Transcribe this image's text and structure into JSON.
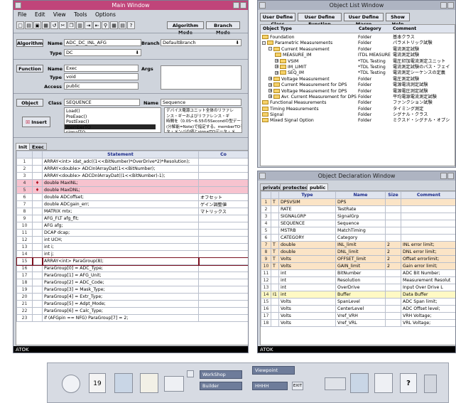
{
  "main_window": {
    "title": "Main Window",
    "menu": [
      "File",
      "Edit",
      "View",
      "Tools",
      "Options"
    ],
    "toolbar_algorithm_mode": "Algorithm Mode",
    "toolbar_branch_mode": "Branch Mode",
    "algorithm_button": "Algorithm",
    "name_label": "Name",
    "name_value": "ADC_DC_INL_AFG",
    "branch_label": "Branch",
    "branch_value": "DefaultBranch",
    "type_label": "Type",
    "type_value": "DC",
    "function_button": "Function",
    "fn_name_value": "Exec",
    "args_label": "Args",
    "fn_type_label": "Type",
    "fn_type_value": "void",
    "access_label": "Access",
    "access_value": "public",
    "object_button": "Object",
    "class_label": "Class",
    "class_value": "SEQUENCE",
    "obj_name_label": "Name",
    "obj_name_value": "Sequence",
    "insert_button": "Insert",
    "method_list": "Load()\nPreExec()\nPostExec()\nmemberTO\nsignalTO",
    "description": "デバイス電源ユニット全体のリファレ\nンス・ギーおよびリファレンス・ギ\n時間を（0.0S～6.55の5Secondの型データ\n(分解能=Note)で指定する。memberTOデー\nタ・メンバの値とsignalTOデータ・メ",
    "tab_init": "Init",
    "tab_exec": "Exec",
    "col_statement": "Statement",
    "col_comment": "Co",
    "status": "ATOK",
    "rows": [
      {
        "n": "1",
        "s": "ARRAY<int>    idat_adc((1<<BitNumber)*OverDrive*2)*Resolution);",
        "c": "",
        "st": "white"
      },
      {
        "n": "2",
        "s": "ARRAY<double> ADCInlArrayDat(1<<BitNumber);",
        "c": "",
        "st": "white"
      },
      {
        "n": "3",
        "s": "ARRAY<double> ADCDnlArrayDat((1<<BitNumber)-1);",
        "c": "",
        "st": "white"
      },
      {
        "n": "4",
        "s": "double        MaxINL;",
        "c": "",
        "st": "pink",
        "mark": "♦"
      },
      {
        "n": "5",
        "s": "double        MaxDNL;",
        "c": "",
        "st": "pink",
        "mark": "♦"
      },
      {
        "n": "6",
        "s": "double        ADCoffset;",
        "c": "オフセット",
        "st": "white"
      },
      {
        "n": "7",
        "s": "double        ADCgain_err;",
        "c": "ゲイン調整値",
        "st": "white"
      },
      {
        "n": "8",
        "s": "MATRIX        mtx;",
        "c": "マトリックス",
        "st": "white"
      },
      {
        "n": "9",
        "s": "AFG_FLT       afg_flt;",
        "c": "",
        "st": "white"
      },
      {
        "n": "10",
        "s": "AFG           afg;",
        "c": "",
        "st": "white"
      },
      {
        "n": "11",
        "s": "DCAP          dcap;",
        "c": "",
        "st": "white"
      },
      {
        "n": "12",
        "s": "int           UCH;",
        "c": "",
        "st": "white"
      },
      {
        "n": "13",
        "s": "int           i;",
        "c": "",
        "st": "white"
      },
      {
        "n": "14",
        "s": "int           j;",
        "c": "",
        "st": "white"
      },
      {
        "n": "15",
        "s": "ARRAY<int> ParaGroup(8);",
        "c": "",
        "st": "selected"
      },
      {
        "n": "16",
        "s": "ParaGroup[0] = ADC_Type;",
        "c": "",
        "st": "white"
      },
      {
        "n": "17",
        "s": "ParaGroup[1] = AFG_Unit;",
        "c": "",
        "st": "white"
      },
      {
        "n": "18",
        "s": "ParaGroup[2] = ADC_Code;",
        "c": "",
        "st": "white"
      },
      {
        "n": "19",
        "s": "ParaGroup[3] = Mask_Type;",
        "c": "",
        "st": "white"
      },
      {
        "n": "20",
        "s": "ParaGroup[4] = Extr_Type;",
        "c": "",
        "st": "white"
      },
      {
        "n": "21",
        "s": "ParaGroup[5] = Adpt_Mode;",
        "c": "",
        "st": "white"
      },
      {
        "n": "22",
        "s": "ParaGroup[6] = Calc_Type;",
        "c": "",
        "st": "white"
      },
      {
        "n": "23",
        "s": "if (AFGpin == NFG) ParaGroup[7] = 2;",
        "c": "",
        "st": "white"
      }
    ]
  },
  "object_list_window": {
    "title": "Object List Window",
    "buttons": [
      "User Define Class",
      "User Define Function",
      "User Define Macro",
      "Show Help"
    ],
    "col_type": "Object Type",
    "col_category": "Category",
    "col_comment": "Comment",
    "items": [
      {
        "t": "Foundation",
        "cat": "Folder",
        "cm": "基本クラス",
        "lvl": 0,
        "exp": ""
      },
      {
        "t": "Parametric Measurements",
        "cat": "Folder",
        "cm": "パラメトリック試験",
        "lvl": 0,
        "exp": "-"
      },
      {
        "t": "Current Measurement",
        "cat": "Folder",
        "cm": "電流測定試験",
        "lvl": 1,
        "exp": "-"
      },
      {
        "t": "MEASURE_IM",
        "cat": "ITDL MEASURE",
        "cm": "電流測定試験",
        "lvl": 2,
        "exp": ""
      },
      {
        "t": "VSIM",
        "cat": "*TDL Testing",
        "cm": "電圧印加電流測定ユニット",
        "lvl": 2,
        "exp": "+"
      },
      {
        "t": "IM_LIMIT",
        "cat": "*TDL Testing",
        "cm": "電流測定試験のパス・フェイ",
        "lvl": 2,
        "exp": "+"
      },
      {
        "t": "SEQ_IM",
        "cat": "*TDL Testing",
        "cm": "電流測定シーケンスの定義",
        "lvl": 2,
        "exp": "+"
      },
      {
        "t": "Voltage Measurement",
        "cat": "Folder",
        "cm": "電圧測定試験",
        "lvl": 1,
        "exp": "+"
      },
      {
        "t": "Current Measurement for DPS",
        "cat": "Folder",
        "cm": "電源電流測定試験",
        "lvl": 1,
        "exp": "+"
      },
      {
        "t": "Voltage Measurement for DPS",
        "cat": "Folder",
        "cm": "電源電圧測定試験",
        "lvl": 1,
        "exp": "+"
      },
      {
        "t": "Avr. Current Measurement for DPS",
        "cat": "Folder",
        "cm": "平均電源電流測定試験",
        "lvl": 1,
        "exp": "+"
      },
      {
        "t": "Functional Measurements",
        "cat": "Folder",
        "cm": "ファンクション試験",
        "lvl": 0,
        "exp": ""
      },
      {
        "t": "Timing Measurements",
        "cat": "Folder",
        "cm": "タイミング測定",
        "lvl": 0,
        "exp": ""
      },
      {
        "t": "Signal",
        "cat": "Folder",
        "cm": "シグナル・クラス",
        "lvl": 0,
        "exp": ""
      },
      {
        "t": "Mixed Signal Option",
        "cat": "Folder",
        "cm": "ミクスド・シグナル・オプシ",
        "lvl": 0,
        "exp": ""
      }
    ]
  },
  "object_decl_window": {
    "title": "Object Declaration Window",
    "tabs": [
      "private",
      "protected",
      "public"
    ],
    "cols": [
      "Type",
      "Name",
      "Size",
      "Comment"
    ],
    "status": "ATOK",
    "rows": [
      {
        "n": "1",
        "f": "T",
        "t": "DPSVSIM",
        "nm": "DPS",
        "sz": "",
        "cm": "",
        "st": "orange"
      },
      {
        "n": "2",
        "f": "",
        "t": "RATE",
        "nm": "TestRate",
        "sz": "",
        "cm": "",
        "st": "white"
      },
      {
        "n": "3",
        "f": "",
        "t": "SIGNALGRP",
        "nm": "SignalGrp",
        "sz": "",
        "cm": "",
        "st": "white"
      },
      {
        "n": "4",
        "f": "",
        "t": "SEQUENCE",
        "nm": "Sequence",
        "sz": "",
        "cm": "",
        "st": "white"
      },
      {
        "n": "5",
        "f": "",
        "t": "MSTRB",
        "nm": "MatchTiming",
        "sz": "",
        "cm": "",
        "st": "white"
      },
      {
        "n": "6",
        "f": "",
        "t": "CATEGORY",
        "nm": "Category",
        "sz": "",
        "cm": "",
        "st": "white"
      },
      {
        "n": "7",
        "f": "T",
        "t": "double",
        "nm": "INL_limit",
        "sz": "2",
        "cm": "INL error limit;",
        "st": "orange"
      },
      {
        "n": "8",
        "f": "T",
        "t": "double",
        "nm": "DNL_limit",
        "sz": "2",
        "cm": "DNL error limit;",
        "st": "orange"
      },
      {
        "n": "9",
        "f": "T",
        "t": "Volts",
        "nm": "OFFSET_limit",
        "sz": "2",
        "cm": "Offset errorlimit;",
        "st": "orange"
      },
      {
        "n": "10",
        "f": "T",
        "t": "Volts",
        "nm": "GAIN_limit",
        "sz": "2",
        "cm": "Gain error limit;",
        "st": "orange"
      },
      {
        "n": "11",
        "f": "",
        "t": "int",
        "nm": "BitNumber",
        "sz": "",
        "cm": "ADC Bit Number;",
        "st": "white"
      },
      {
        "n": "12",
        "f": "",
        "t": "int",
        "nm": "Resolution",
        "sz": "",
        "cm": "Measurement Resolut",
        "st": "white"
      },
      {
        "n": "13",
        "f": "",
        "t": "int",
        "nm": "OverDrive",
        "sz": "",
        "cm": "Input Over Drive L",
        "st": "white"
      },
      {
        "n": "14",
        "f": "I1",
        "t": "int",
        "nm": "Buffer",
        "sz": "",
        "cm": "Data Buffer",
        "st": "yellow"
      },
      {
        "n": "15",
        "f": "",
        "t": "Volts",
        "nm": "SpanLevel",
        "sz": "",
        "cm": "ADC Span limit;",
        "st": "white"
      },
      {
        "n": "16",
        "f": "",
        "t": "Volts",
        "nm": "CenterLevel",
        "sz": "",
        "cm": "ADC Offset level;",
        "st": "white"
      },
      {
        "n": "17",
        "f": "",
        "t": "Volts",
        "nm": "Vref_VRH",
        "sz": "",
        "cm": "VRH Voltage;",
        "st": "white"
      },
      {
        "n": "18",
        "f": "",
        "t": "Volts",
        "nm": "Vref_VRL",
        "sz": "",
        "cm": "VRL Voltage;",
        "st": "white"
      }
    ]
  },
  "front_panel": {
    "workspace_1": "WorkShop",
    "workspace_2": "Viewpoint",
    "workspace_3": "Builder",
    "workspace_4": "HHHH",
    "exit_label": "EXIT",
    "calendar_day": "19"
  }
}
